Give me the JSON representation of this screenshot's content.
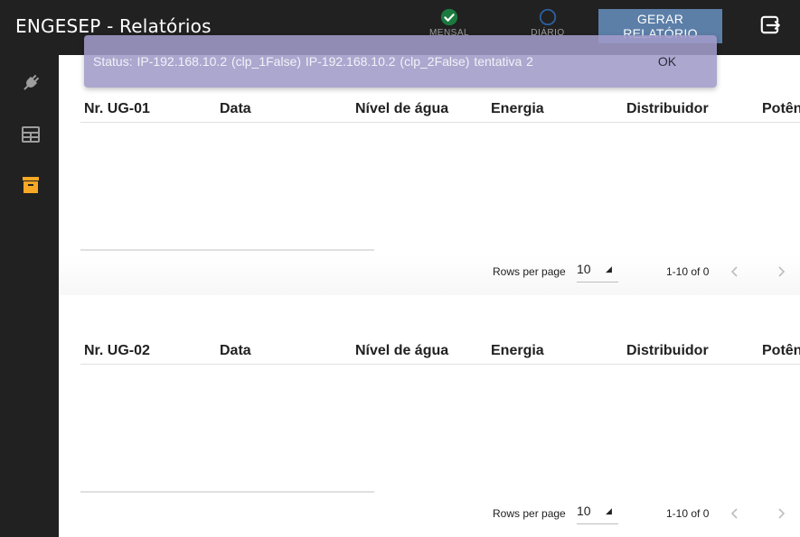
{
  "header": {
    "title": "ENGESEP - Relatórios",
    "options": [
      {
        "label": "MENSAL",
        "selected": true
      },
      {
        "label": "DIÁRIO",
        "selected": false
      }
    ],
    "generate_label": "GERAR RELATÓRIO",
    "logout_icon": "logout-icon"
  },
  "sidebar": {
    "items": [
      {
        "icon": "plug-icon"
      },
      {
        "icon": "table-icon"
      },
      {
        "icon": "archive-icon"
      }
    ]
  },
  "tables": [
    {
      "columns": [
        "Nr. UG-01",
        "Data",
        "Nível de água",
        "Energia",
        "Distribuidor",
        "Potên"
      ],
      "rows_per_page_label": "Rows per page",
      "rows_per_page": "10",
      "range": "1-10 of 0"
    },
    {
      "columns": [
        "Nr. UG-02",
        "Data",
        "Nível de água",
        "Energia",
        "Distribuidor",
        "Potên"
      ],
      "rows_per_page_label": "Rows per page",
      "rows_per_page": "10",
      "range": "1-10 of 0"
    }
  ],
  "snackbar": {
    "message": "Status: IP-192.168.10.2 (clp_1False)  IP-192.168.10.2 (clp_2False)  tentativa 2",
    "ok_label": "OK"
  },
  "colors": {
    "topbar": "#212121",
    "primary_button": "#5c7fa8",
    "radio_checked": "#1b7a3e",
    "radio_unchecked": "#2c5f9e",
    "sidebar_active": "#f9a825",
    "sidebar_icon": "#9e9e9e",
    "snackbar_bg": "#a09bc8"
  }
}
